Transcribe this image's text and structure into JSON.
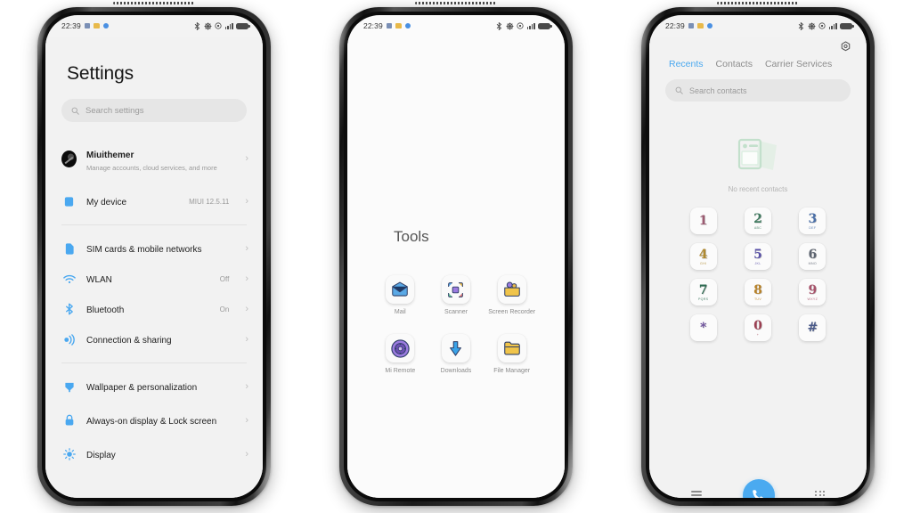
{
  "statusbar": {
    "time": "22:39"
  },
  "phone1": {
    "title": "Settings",
    "search_placeholder": "Search settings",
    "account": {
      "name": "Miuithemer",
      "subtitle": "Manage accounts, cloud services, and more"
    },
    "rows": [
      {
        "label": "My device",
        "value": "MIUI 12.5.11",
        "icon": "device-icon"
      },
      {
        "label": "SIM cards & mobile networks",
        "value": "",
        "icon": "sim-icon"
      },
      {
        "label": "WLAN",
        "value": "Off",
        "icon": "wifi-icon"
      },
      {
        "label": "Bluetooth",
        "value": "On",
        "icon": "bluetooth-icon"
      },
      {
        "label": "Connection & sharing",
        "value": "",
        "icon": "connection-icon"
      },
      {
        "label": "Wallpaper & personalization",
        "value": "",
        "icon": "wallpaper-icon"
      },
      {
        "label": "Always-on display & Lock screen",
        "value": "",
        "icon": "lock-icon"
      },
      {
        "label": "Display",
        "value": "",
        "icon": "brightness-icon"
      }
    ]
  },
  "phone2": {
    "folder_title": "Tools",
    "apps": [
      {
        "name": "Mail",
        "icon": "mail-icon"
      },
      {
        "name": "Scanner",
        "icon": "scanner-icon"
      },
      {
        "name": "Screen Recorder",
        "icon": "screen-recorder-icon"
      },
      {
        "name": "Mi Remote",
        "icon": "mi-remote-icon"
      },
      {
        "name": "Downloads",
        "icon": "downloads-icon"
      },
      {
        "name": "File Manager",
        "icon": "file-manager-icon"
      }
    ]
  },
  "phone3": {
    "tabs": [
      {
        "label": "Recents",
        "active": true
      },
      {
        "label": "Contacts",
        "active": false
      },
      {
        "label": "Carrier Services",
        "active": false
      }
    ],
    "search_placeholder": "Search contacts",
    "empty_text": "No recent contacts",
    "keys": [
      {
        "digit": "1",
        "letters": "",
        "color": "#9c5b72"
      },
      {
        "digit": "2",
        "letters": "ABC",
        "color": "#3f7a5f"
      },
      {
        "digit": "3",
        "letters": "DEF",
        "color": "#4a6fa8"
      },
      {
        "digit": "4",
        "letters": "GHI",
        "color": "#b08a30"
      },
      {
        "digit": "5",
        "letters": "JKL",
        "color": "#5a52a8"
      },
      {
        "digit": "6",
        "letters": "MNO",
        "color": "#5d6470"
      },
      {
        "digit": "7",
        "letters": "PQRS",
        "color": "#2e6b52"
      },
      {
        "digit": "8",
        "letters": "TUV",
        "color": "#b8832a"
      },
      {
        "digit": "9",
        "letters": "WXYZ",
        "color": "#a8536b"
      },
      {
        "digit": "*",
        "letters": "",
        "color": "#6a4c9c"
      },
      {
        "digit": "0",
        "letters": "+",
        "color": "#9c3f52"
      },
      {
        "digit": "#",
        "letters": "",
        "color": "#4a5a8a"
      }
    ],
    "bottom": {
      "menu": "menu-icon",
      "call": "call-icon",
      "keypad": "keypad-icon"
    },
    "accent": "#4aaaf0"
  }
}
